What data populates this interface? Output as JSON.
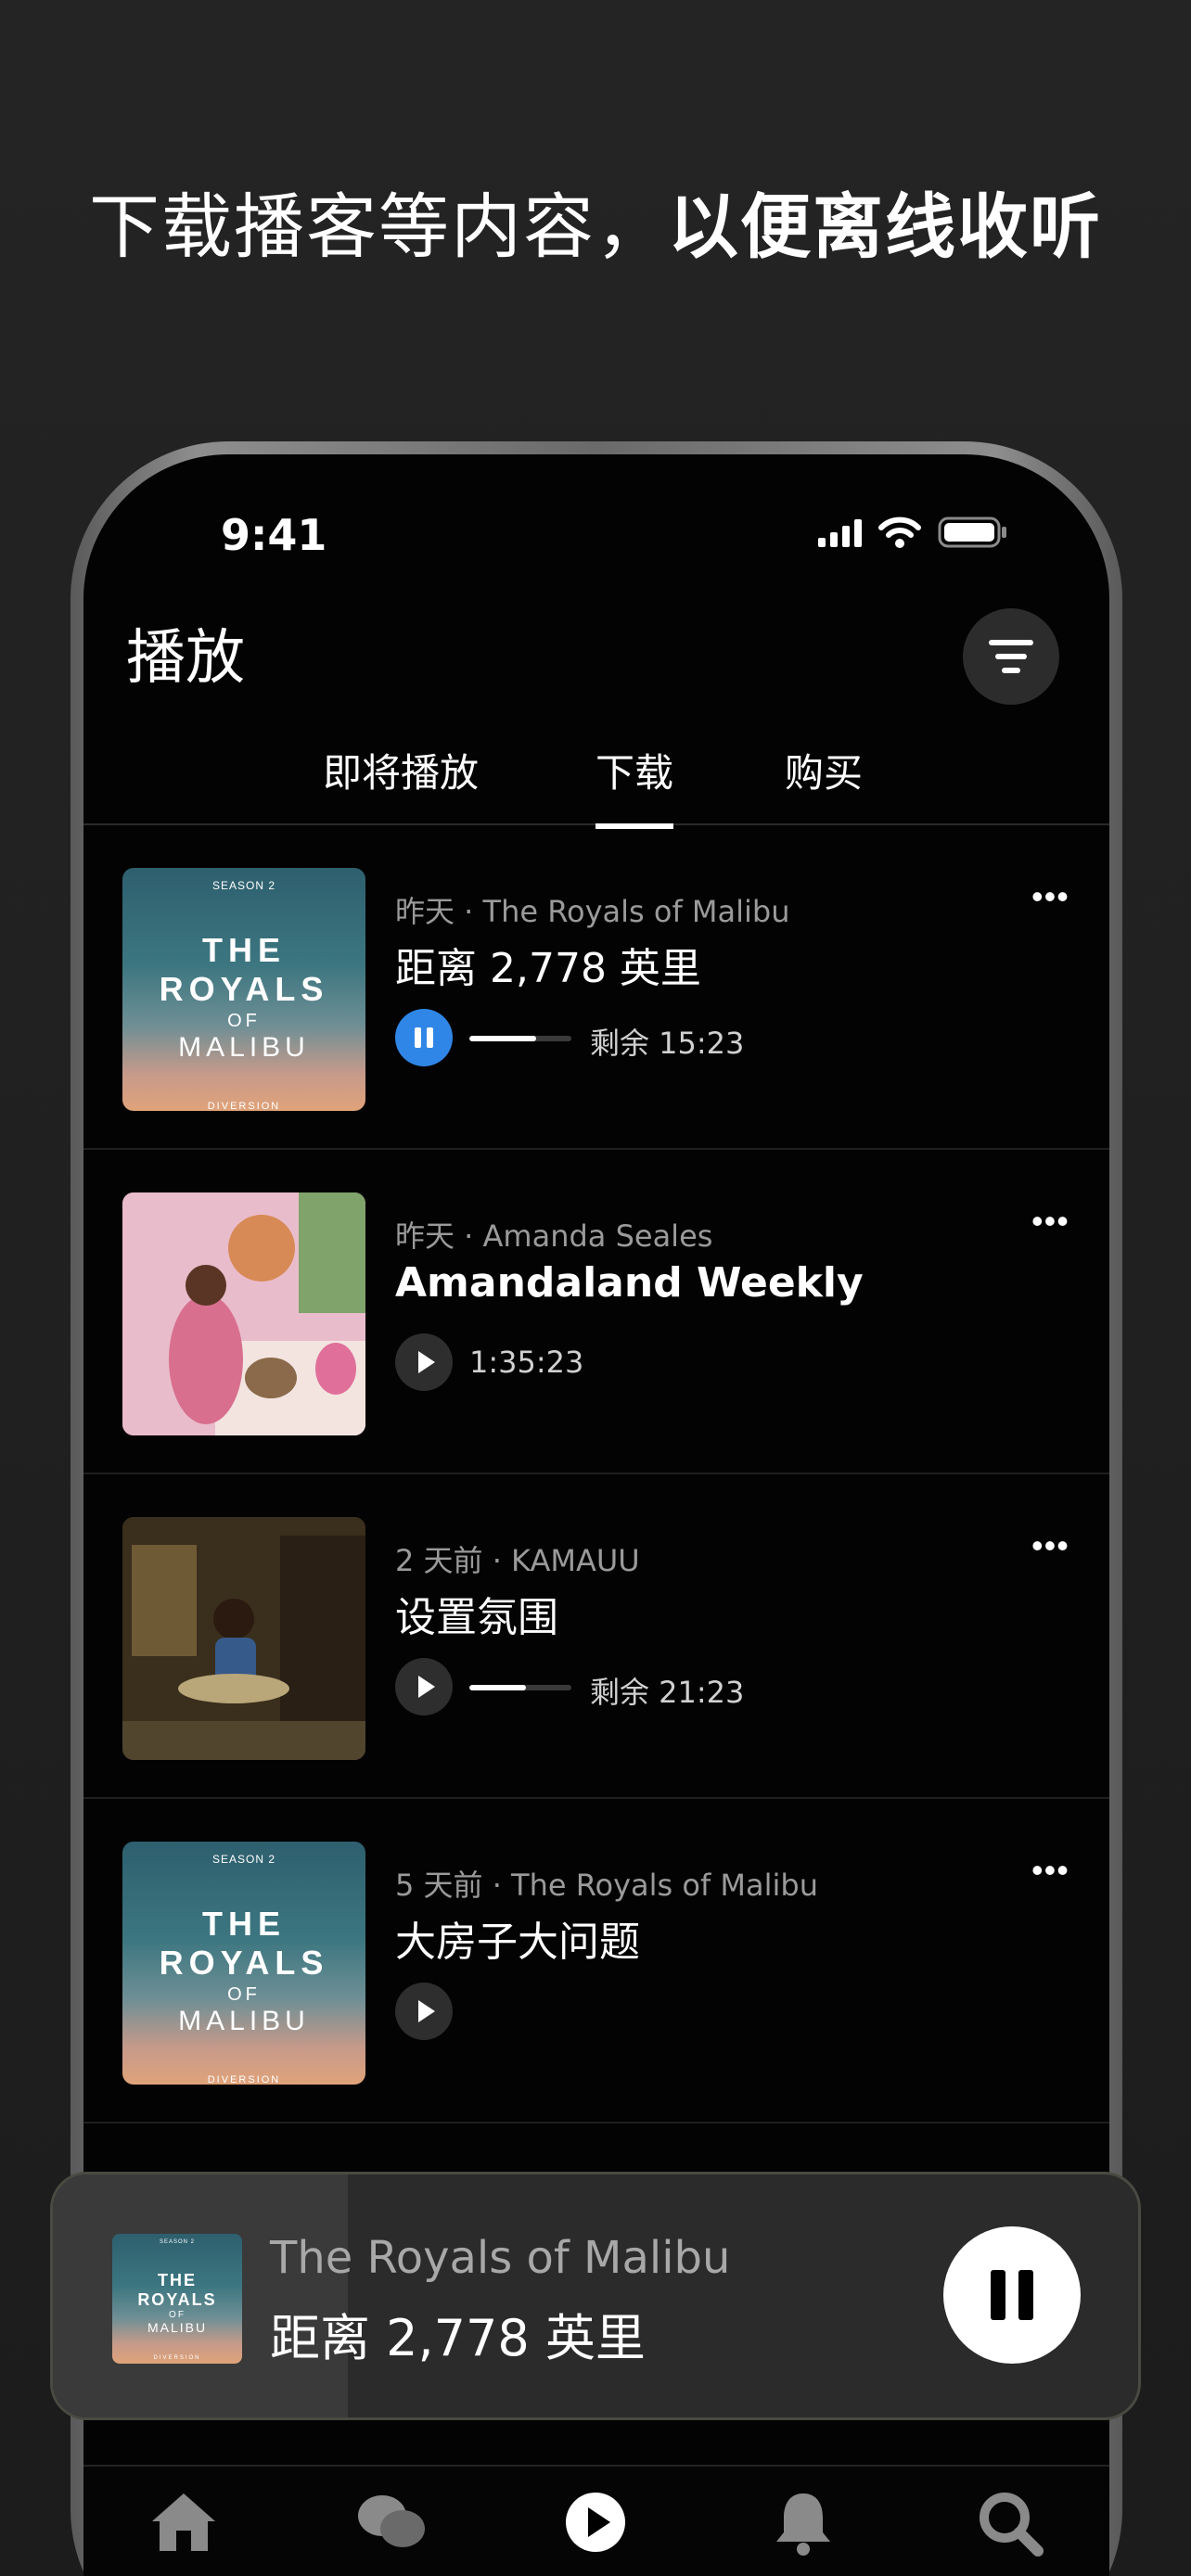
{
  "headline": {
    "regular": "下载播客等内容，",
    "bold": "以便离线收听"
  },
  "status_bar": {
    "time": "9:41"
  },
  "header": {
    "title": "播放",
    "filter_icon": "filter-icon"
  },
  "tabs": [
    {
      "label": "即将播放",
      "active": false
    },
    {
      "label": "下载",
      "active": true
    },
    {
      "label": "购买",
      "active": false
    }
  ],
  "episodes": [
    {
      "meta": "昨天 · The Royals of Malibu",
      "title": "距离 2,778 英里",
      "state": "pause",
      "progress": 0.65,
      "time": "剩余 15:23"
    },
    {
      "meta": "昨天 · Amanda Seales",
      "title": "Amandaland Weekly",
      "state": "play",
      "time": "1:35:23"
    },
    {
      "meta": "2 天前 · KAMAUU",
      "title": "设置氛围",
      "state": "play",
      "progress": 0.55,
      "time": "剩余 21:23"
    },
    {
      "meta": "5 天前 · The Royals of Malibu",
      "title": "大房子大问题",
      "state": "play"
    }
  ],
  "artwork": {
    "season": "SEASON 2",
    "line1": "THE",
    "line2": "ROYALS",
    "line3": "OF",
    "line4": "MALIBU",
    "brand": "DIVERSION"
  },
  "more_label": "•••",
  "mini_player": {
    "show": "The Royals of Malibu",
    "episode": "距离 2,778 英里",
    "progress": 0.27
  },
  "tab_bar": [
    "home-icon",
    "chat-icon",
    "play-icon",
    "bell-icon",
    "search-icon"
  ],
  "colors": {
    "accent": "#2f86e6",
    "background": "#030303"
  }
}
